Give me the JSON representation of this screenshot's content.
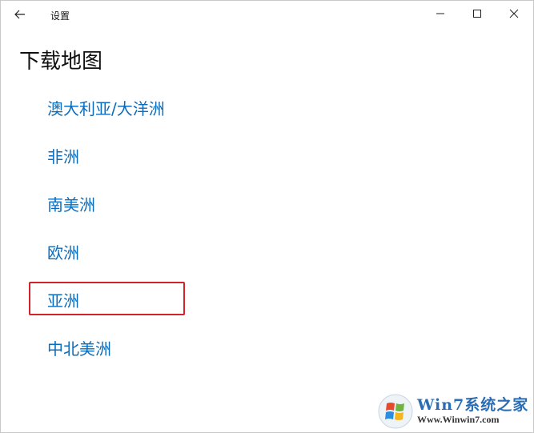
{
  "window": {
    "title": "设置"
  },
  "page": {
    "title": "下载地图"
  },
  "regions": [
    {
      "label": "澳大利亚/大洋洲"
    },
    {
      "label": "非洲"
    },
    {
      "label": "南美洲"
    },
    {
      "label": "欧洲"
    },
    {
      "label": "亚洲"
    },
    {
      "label": "中北美洲"
    }
  ],
  "watermark": {
    "name": "Win7系统之家",
    "url": "Www.Winwin7.com"
  },
  "colors": {
    "link": "#0b6cbd",
    "highlight": "#d3222a"
  },
  "icons": {
    "back": "back-arrow-icon",
    "minimize": "minimize-icon",
    "maximize": "maximize-icon",
    "close": "close-icon"
  }
}
